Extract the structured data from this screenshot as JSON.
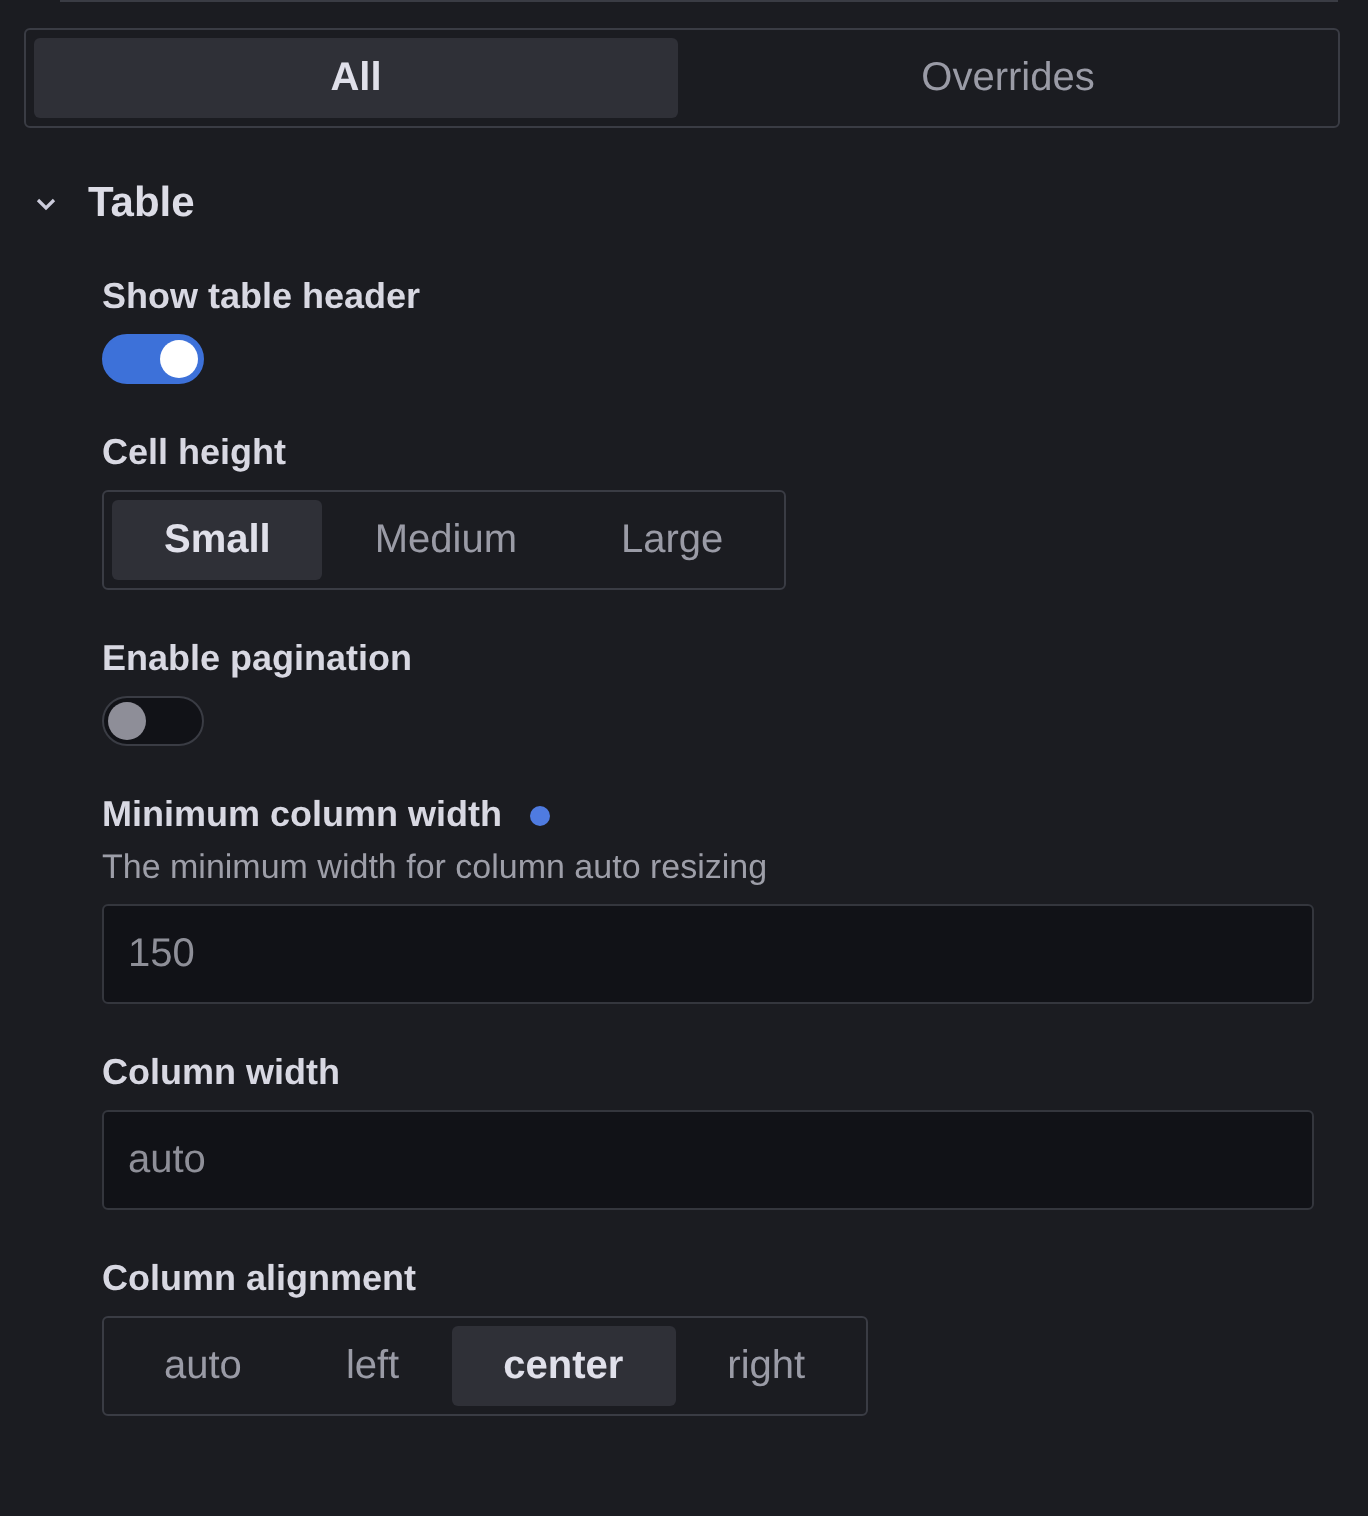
{
  "tabs": [
    {
      "label": "All",
      "selected": true
    },
    {
      "label": "Overrides",
      "selected": false
    }
  ],
  "section": {
    "title": "Table",
    "expanded": true,
    "options": [
      {
        "kind": "switch",
        "label": "Show table header",
        "on": true
      },
      {
        "kind": "radio",
        "label": "Cell height",
        "choices": [
          {
            "label": "Small",
            "selected": true
          },
          {
            "label": "Medium",
            "selected": false
          },
          {
            "label": "Large",
            "selected": false
          }
        ]
      },
      {
        "kind": "switch",
        "label": "Enable pagination",
        "on": false
      },
      {
        "kind": "input",
        "label": "Minimum column width",
        "modified": true,
        "description": "The minimum width for column auto resizing",
        "placeholder": "150"
      },
      {
        "kind": "input",
        "label": "Column width",
        "modified": false,
        "placeholder": "auto"
      },
      {
        "kind": "radio",
        "label": "Column alignment",
        "choices": [
          {
            "label": "auto",
            "selected": false
          },
          {
            "label": "left",
            "selected": false
          },
          {
            "label": "center",
            "selected": true
          },
          {
            "label": "right",
            "selected": false
          }
        ]
      }
    ]
  }
}
